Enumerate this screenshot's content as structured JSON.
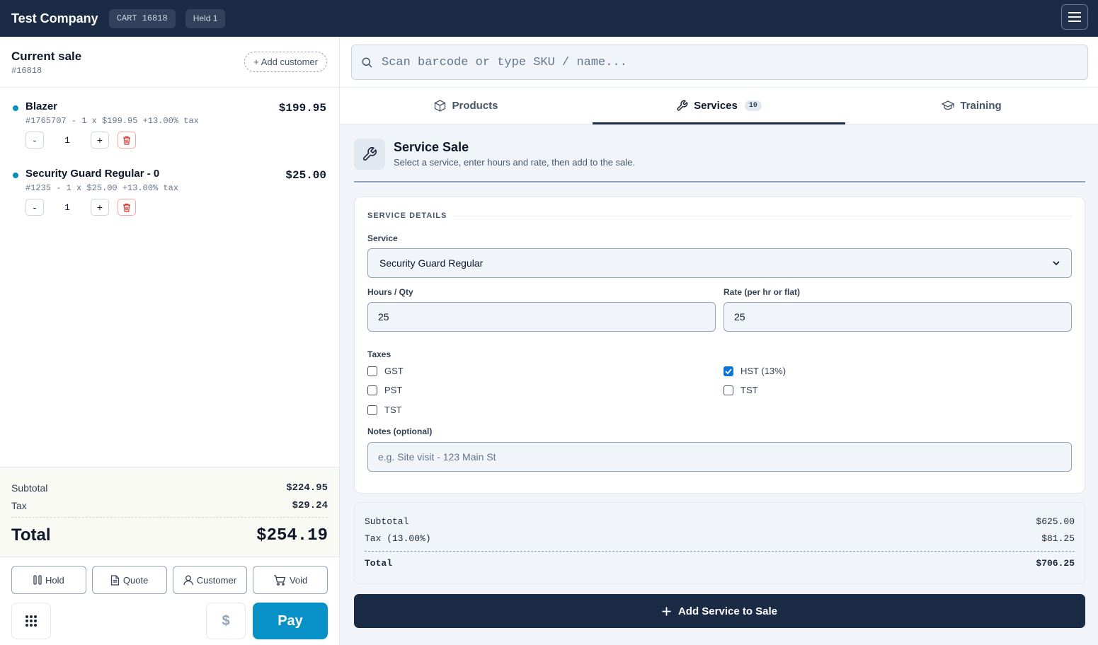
{
  "topbar": {
    "company": "Test Company",
    "cart_badge": "CART 16818",
    "held_badge": "Held 1"
  },
  "sale": {
    "title": "Current sale",
    "number": "#16818",
    "add_customer": "+ Add customer",
    "items": [
      {
        "name": "Blazer",
        "price": "$199.95",
        "meta": "#1765707 - 1 x $199.95 +13.00% tax",
        "qty": "1",
        "minus": "-",
        "plus": "+"
      },
      {
        "name": "Security Guard Regular - 0",
        "price": "$25.00",
        "meta": "#1235 - 1 x $25.00 +13.00% tax",
        "qty": "1",
        "minus": "-",
        "plus": "+"
      }
    ]
  },
  "totals": {
    "subtotal_label": "Subtotal",
    "subtotal": "$224.95",
    "tax_label": "Tax",
    "tax": "$29.24",
    "total_label": "Total",
    "total": "$254.19"
  },
  "actions": {
    "hold": "Hold",
    "quote": "Quote",
    "customer": "Customer",
    "void": "Void",
    "cash_symbol": "$",
    "pay": "Pay"
  },
  "search": {
    "placeholder": "Scan barcode or type SKU / name..."
  },
  "tabs": [
    {
      "label": "Products",
      "icon": "box-icon"
    },
    {
      "label": "Services",
      "icon": "wrench-icon",
      "badge": "10",
      "active": true
    },
    {
      "label": "Training",
      "icon": "graduation-cap-icon"
    }
  ],
  "service": {
    "title": "Service Sale",
    "subtitle": "Select a service, enter hours and rate, then add to the sale.",
    "section": "SERVICE DETAILS",
    "service_label": "Service",
    "service_value": "Security Guard Regular",
    "hours_label": "Hours / Qty",
    "hours_value": "25",
    "rate_label": "Rate (per hr or flat)",
    "rate_value": "25",
    "taxes_label": "Taxes",
    "taxes": [
      {
        "label": "GST",
        "checked": false
      },
      {
        "label": "HST (13%)",
        "checked": true
      },
      {
        "label": "PST",
        "checked": false
      },
      {
        "label": "TST",
        "checked": false
      },
      {
        "label": "TST",
        "checked": false
      }
    ],
    "notes_label": "Notes (optional)",
    "notes_placeholder": "e.g. Site visit - 123 Main St"
  },
  "service_summary": {
    "subtotal_label": "Subtotal",
    "subtotal": "$625.00",
    "tax_label": "Tax (13.00%)",
    "tax": "$81.25",
    "total_label": "Total",
    "total": "$706.25"
  },
  "add_service_button": "Add Service to Sale",
  "colors": {
    "navy": "#1b2a45",
    "accent": "#0891c6",
    "item_dot": "#0891b2",
    "checkbox_on": "#0b74d6"
  }
}
